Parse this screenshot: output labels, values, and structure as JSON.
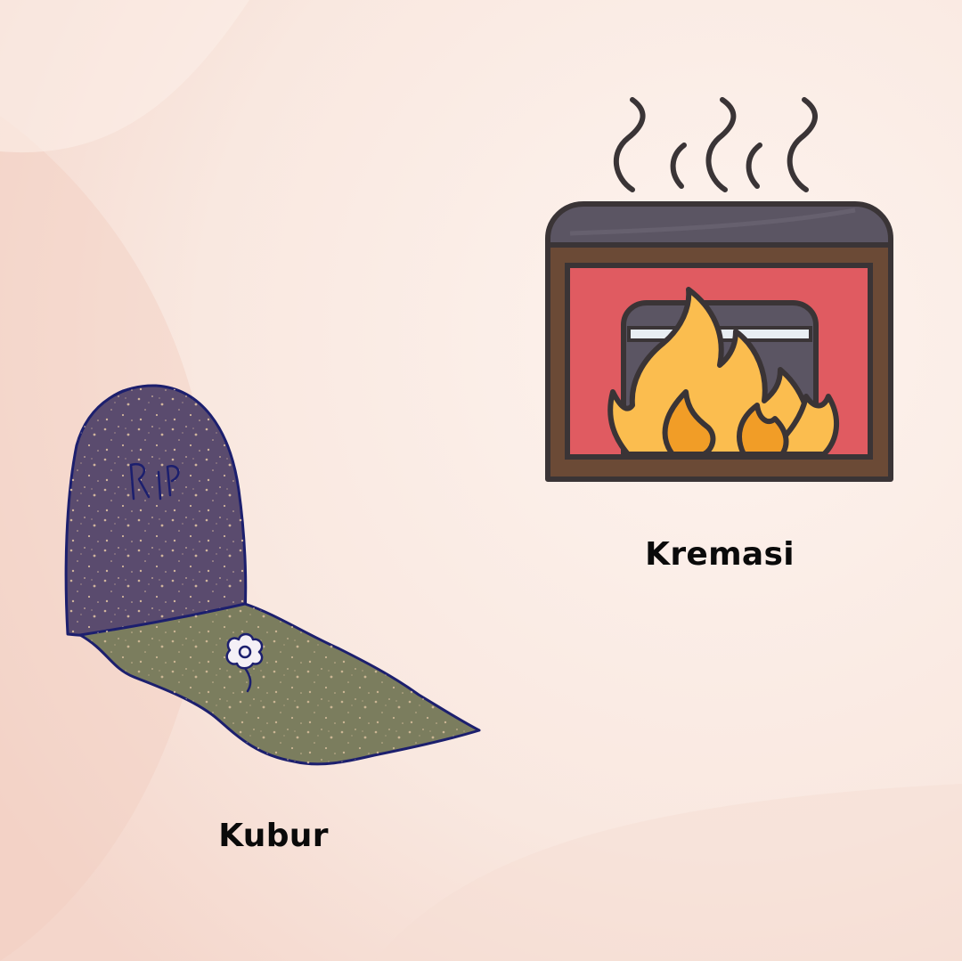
{
  "colors": {
    "background": "#f8e4dc",
    "background_light": "#fdf3ee",
    "caption_text": "#0a0a0a",
    "tombstone": "#5a4b6e",
    "tombstone_outline": "#1c1f6e",
    "grave_ground": "#7b7d5e",
    "speckle": "#e5c7a4",
    "furnace_top": "#5b5563",
    "furnace_frame": "#6b4a36",
    "furnace_window": "#e05b61",
    "flame_outer": "#fbbd4f",
    "flame_inner": "#f19d27",
    "outline": "#3a3436"
  },
  "items": [
    {
      "id": "kremasi",
      "label": "Kremasi",
      "icon": "cremation-furnace-icon"
    },
    {
      "id": "kubur",
      "label": "Kubur",
      "icon": "tombstone-grave-icon",
      "engraving": "RIP"
    }
  ]
}
